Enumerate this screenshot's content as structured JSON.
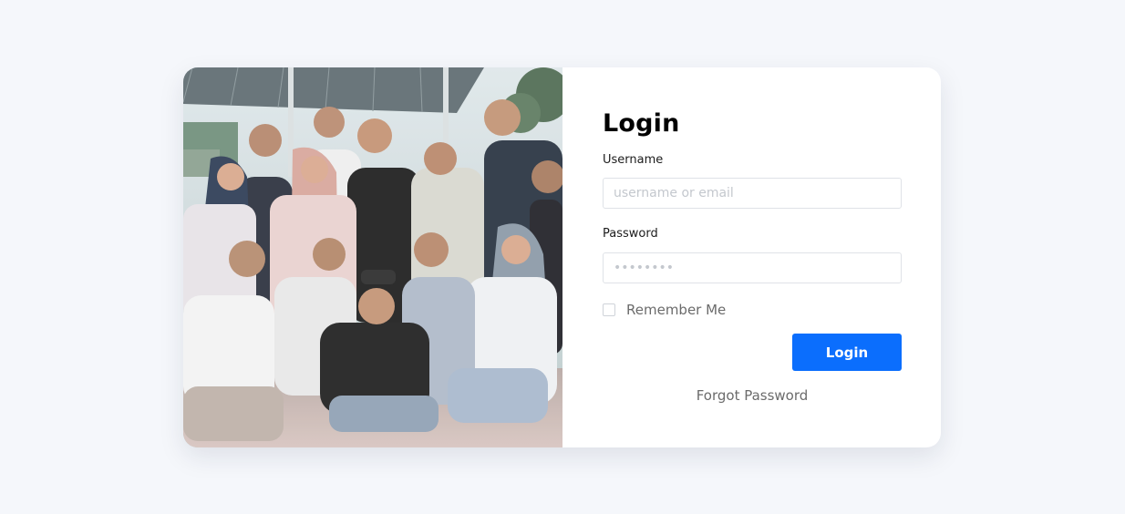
{
  "login_form": {
    "title": "Login",
    "username_label": "Username",
    "username_placeholder": "username or email",
    "password_label": "Password",
    "password_placeholder": "••••••••",
    "remember_label": "Remember Me",
    "remember_checked": false,
    "submit_label": "Login",
    "forgot_label": "Forgot Password"
  },
  "photo": {
    "icon": "group-photo-illustration"
  },
  "colors": {
    "page_background": "#f5f7fb",
    "card_background": "#ffffff",
    "primary_button": "#0b6efd",
    "input_border": "#dfe2e7",
    "muted_text": "#6b6b6b"
  }
}
